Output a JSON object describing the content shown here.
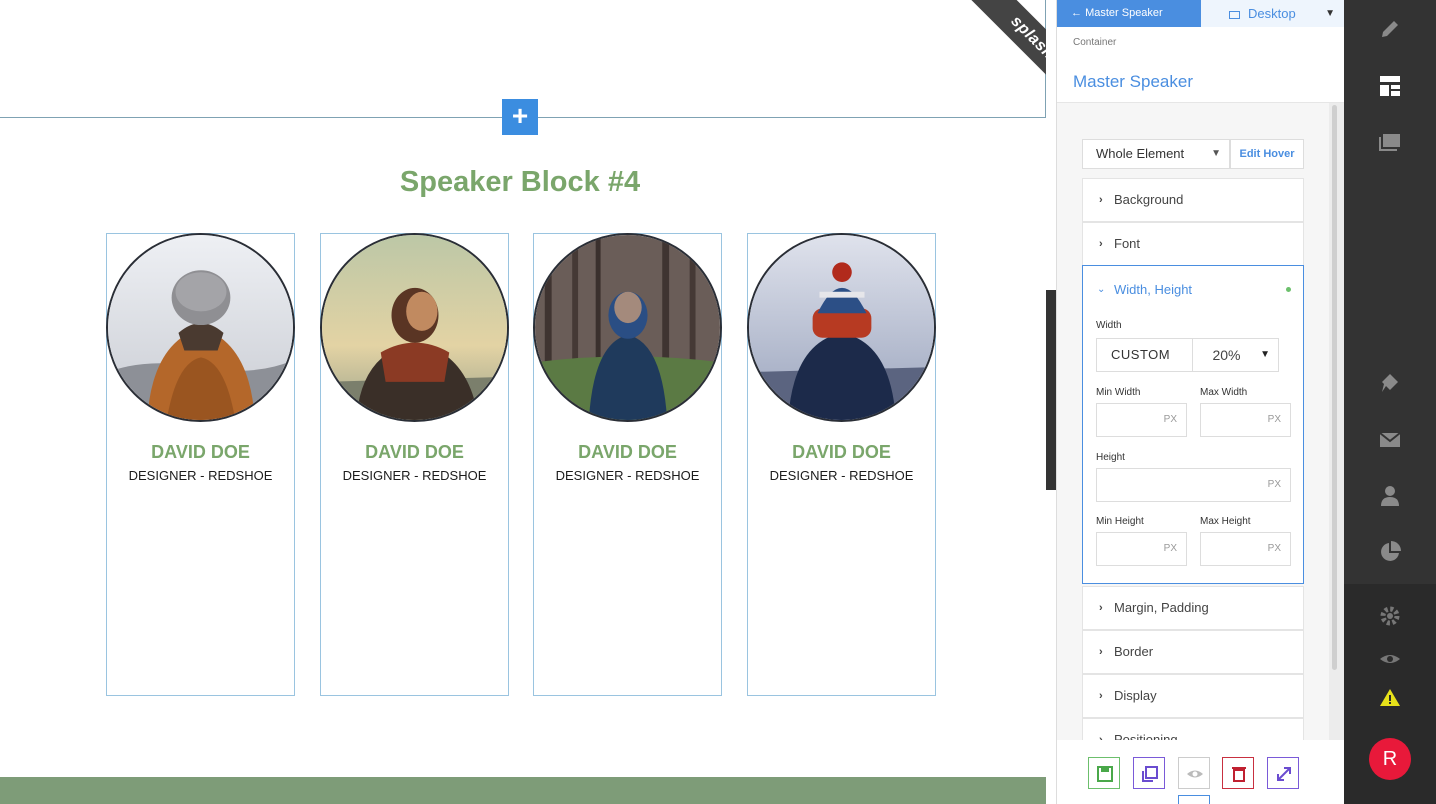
{
  "canvas": {
    "ribbon_text": "splash",
    "section_title": "Speaker Block #4",
    "add_symbol": "+",
    "speakers": [
      {
        "name": "DAVID DOE",
        "role": "DESIGNER - REDSHOE"
      },
      {
        "name": "DAVID DOE",
        "role": "DESIGNER - REDSHOE"
      },
      {
        "name": "DAVID DOE",
        "role": "DESIGNER - REDSHOE"
      },
      {
        "name": "DAVID DOE",
        "role": "DESIGNER - REDSHOE"
      }
    ]
  },
  "panel": {
    "tab_label": "Master Speaker",
    "device_label": "Desktop",
    "breadcrumb": "Container",
    "title": "Master Speaker",
    "state_select": "Whole Element",
    "edit_hover": "Edit Hover",
    "sections": {
      "background": "Background",
      "font": "Font",
      "width_height": "Width, Height",
      "margin_padding": "Margin, Padding",
      "border": "Border",
      "display": "Display",
      "positioning": "Positioning"
    },
    "width_height": {
      "width_label": "Width",
      "width_unit": "CUSTOM",
      "width_value": "20%",
      "min_width_label": "Min Width",
      "max_width_label": "Max Width",
      "height_label": "Height",
      "min_height_label": "Min Height",
      "max_height_label": "Max Height",
      "unit": "PX"
    }
  },
  "toolbar": {
    "avatar_letter": "R"
  },
  "colors": {
    "accent_blue": "#4a8ee0",
    "speaker_green": "#7aa66b",
    "toolbar_dark": "#333333",
    "avatar_red": "#e8193a"
  },
  "icons": [
    "arrow-left-icon",
    "monitor-icon",
    "chevron-down-icon",
    "pencil-icon",
    "layout-icon",
    "gallery-icon",
    "rocket-icon",
    "mail-icon",
    "user-icon",
    "pie-chart-icon",
    "gear-icon",
    "eye-icon",
    "warning-icon",
    "save-icon",
    "copy-icon",
    "trash-icon",
    "expand-icon"
  ]
}
